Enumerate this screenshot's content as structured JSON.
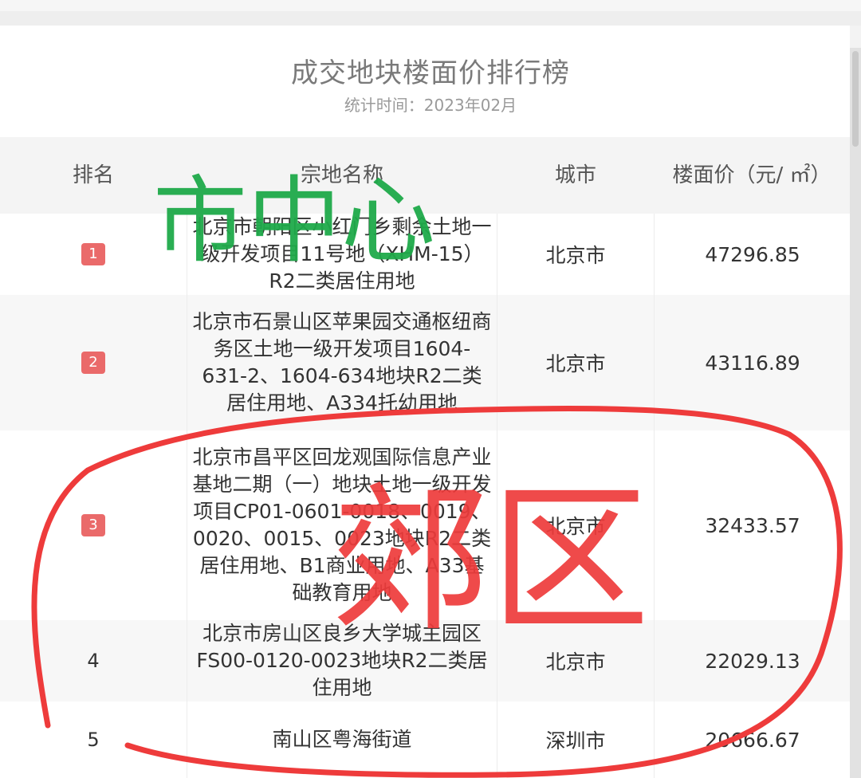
{
  "title": "成交地块楼面价排行榜",
  "subtitle": "统计时间：2023年02月",
  "headers": {
    "rank": "排名",
    "name": "宗地名称",
    "city": "城市",
    "price": "楼面价（元/ ㎡）"
  },
  "rows": [
    {
      "rank": "1",
      "name": "北京市朝阳区小红门乡剩余土地一级开发项目11号地（XHM-15）R2二类居住用地",
      "city": "北京市",
      "price": "47296.85"
    },
    {
      "rank": "2",
      "name": "北京市石景山区苹果园交通枢纽商务区土地一级开发项目1604-631-2、1604-634地块R2二类居住用地、A334托幼用地",
      "city": "北京市",
      "price": "43116.89"
    },
    {
      "rank": "3",
      "name": "北京市昌平区回龙观国际信息产业基地二期（一）地块土地一级开发项目CP01-0601-0018、0019、0020、0015、0023地块R2二类居住用地、B1商业用地、A33基础教育用地",
      "city": "北京市",
      "price": "32433.57"
    },
    {
      "rank": "4",
      "name": "北京市房山区良乡大学城主园区FS00-0120-0023地块R2二类居住用地",
      "city": "北京市",
      "price": "22029.13"
    },
    {
      "rank": "5",
      "name": "南山区粤海街道",
      "city": "深圳市",
      "price": "20666.67"
    }
  ],
  "annotations": {
    "green_text": "市中心",
    "red_text": "郊区",
    "green_color": "#1faa4a",
    "red_color": "#ee3b3b"
  },
  "colors": {
    "badge": "#ea6a6a",
    "header_bg": "#f4f4f4"
  }
}
